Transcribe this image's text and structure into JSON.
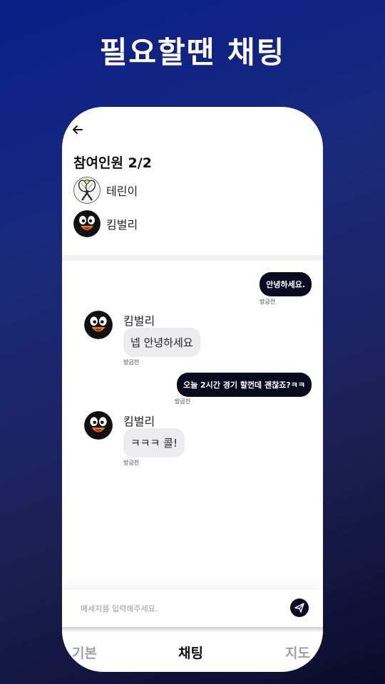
{
  "headline": "필요할땐 채팅",
  "participants": {
    "title": "참여인원 2/2",
    "list": [
      {
        "name": "테린이",
        "avatar": "tennis-racket-avatar"
      },
      {
        "name": "킴벌리",
        "avatar": "penguin-avatar"
      }
    ]
  },
  "messages": [
    {
      "from": "me",
      "text": "안녕하세요.",
      "time": "방금전"
    },
    {
      "from": "other",
      "sender": "킴벌리",
      "text": "넵 안녕하세요",
      "time": "방금전"
    },
    {
      "from": "me",
      "text": "오늘 2시간 경기 할껀데 괜찮죠?ㅋㅋ",
      "time": "방금전"
    },
    {
      "from": "other",
      "sender": "킴벌리",
      "text": "ㅋㅋㅋ 콜!",
      "time": "방금전"
    }
  ],
  "input": {
    "placeholder": "메세지를 입력해주세요."
  },
  "tabs": [
    {
      "label": "기본",
      "active": false
    },
    {
      "label": "채팅",
      "active": true
    },
    {
      "label": "지도",
      "active": false
    }
  ],
  "colors": {
    "accent_dark": "#080a1e",
    "bubble_other": "#ececef",
    "tab_inactive": "#a0a0a8"
  }
}
